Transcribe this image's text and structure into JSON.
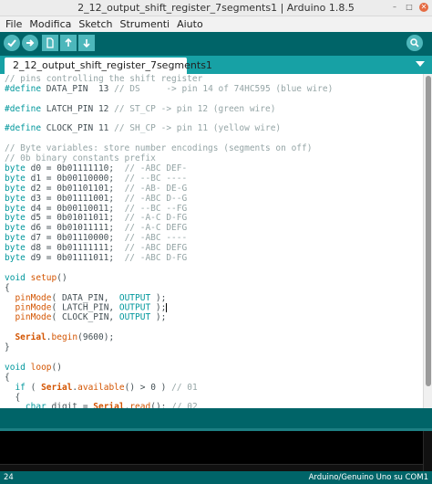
{
  "window": {
    "title": "2_12_output_shift_register_7segments1 | Arduino 1.8.5"
  },
  "menu": [
    "File",
    "Modifica",
    "Sketch",
    "Strumenti",
    "Aiuto"
  ],
  "toolbar": {
    "buttons": [
      "verify-icon",
      "upload-icon",
      "new-icon",
      "open-icon",
      "save-icon",
      "serial-monitor-icon"
    ]
  },
  "tabs": [
    {
      "label": "2_12_output_shift_register_7segments1"
    }
  ],
  "editor": {
    "lines": [
      [
        [
          "cm",
          "// pins controlling the shift register"
        ]
      ],
      [
        [
          "kw",
          "#define"
        ],
        [
          "",
          " DATA_PIN  13 "
        ],
        [
          "cm",
          "// DS     -> pin 14 of 74HC595 (blue wire)"
        ]
      ],
      [
        [
          "",
          ""
        ]
      ],
      [
        [
          "kw",
          "#define"
        ],
        [
          "",
          " LATCH_PIN 12 "
        ],
        [
          "cm",
          "// ST_CP -> pin 12 (green wire)"
        ]
      ],
      [
        [
          "",
          ""
        ]
      ],
      [
        [
          "kw",
          "#define"
        ],
        [
          "",
          " CLOCK_PIN 11 "
        ],
        [
          "cm",
          "// SH_CP -> pin 11 (yellow wire)"
        ]
      ],
      [
        [
          "",
          ""
        ]
      ],
      [
        [
          "cm",
          "// Byte variables: store number encodings (segments on off)"
        ]
      ],
      [
        [
          "cm",
          "// 0b binary constants prefix"
        ]
      ],
      [
        [
          "kw",
          "byte"
        ],
        [
          "",
          " d0 = 0b01111110;  "
        ],
        [
          "cm",
          "// -ABC DEF-"
        ]
      ],
      [
        [
          "kw",
          "byte"
        ],
        [
          "",
          " d1 = 0b00110000;  "
        ],
        [
          "cm",
          "// --BC ----"
        ]
      ],
      [
        [
          "kw",
          "byte"
        ],
        [
          "",
          " d2 = 0b01101101;  "
        ],
        [
          "cm",
          "// -AB- DE-G"
        ]
      ],
      [
        [
          "kw",
          "byte"
        ],
        [
          "",
          " d3 = 0b01111001;  "
        ],
        [
          "cm",
          "// -ABC D--G"
        ]
      ],
      [
        [
          "kw",
          "byte"
        ],
        [
          "",
          " d4 = 0b00110011;  "
        ],
        [
          "cm",
          "// --BC --FG"
        ]
      ],
      [
        [
          "kw",
          "byte"
        ],
        [
          "",
          " d5 = 0b01011011;  "
        ],
        [
          "cm",
          "// -A-C D-FG"
        ]
      ],
      [
        [
          "kw",
          "byte"
        ],
        [
          "",
          " d6 = 0b01011111;  "
        ],
        [
          "cm",
          "// -A-C DEFG"
        ]
      ],
      [
        [
          "kw",
          "byte"
        ],
        [
          "",
          " d7 = 0b01110000;  "
        ],
        [
          "cm",
          "// -ABC ----"
        ]
      ],
      [
        [
          "kw",
          "byte"
        ],
        [
          "",
          " d8 = 0b01111111;  "
        ],
        [
          "cm",
          "// -ABC DEFG"
        ]
      ],
      [
        [
          "kw",
          "byte"
        ],
        [
          "",
          " d9 = 0b01111011;  "
        ],
        [
          "cm",
          "// -ABC D-FG"
        ]
      ],
      [
        [
          "",
          ""
        ]
      ],
      [
        [
          "kw",
          "void"
        ],
        [
          "",
          " "
        ],
        [
          "fn",
          "setup"
        ],
        [
          "",
          "()"
        ]
      ],
      [
        [
          "",
          "{"
        ]
      ],
      [
        [
          "",
          "  "
        ],
        [
          "fn",
          "pinMode"
        ],
        [
          "",
          "( DATA_PIN,  "
        ],
        [
          "kw",
          "OUTPUT"
        ],
        [
          "",
          " );"
        ]
      ],
      [
        [
          "",
          "  "
        ],
        [
          "fn",
          "pinMode"
        ],
        [
          "",
          "( LATCH_PIN, "
        ],
        [
          "kw",
          "OUTPUT"
        ],
        [
          "",
          " );"
        ],
        [
          "caret",
          ""
        ]
      ],
      [
        [
          "",
          "  "
        ],
        [
          "fn",
          "pinMode"
        ],
        [
          "",
          "( CLOCK_PIN, "
        ],
        [
          "kw",
          "OUTPUT"
        ],
        [
          "",
          " );"
        ]
      ],
      [
        [
          "",
          ""
        ]
      ],
      [
        [
          "",
          "  "
        ],
        [
          "cls",
          "Serial"
        ],
        [
          "",
          "."
        ],
        [
          "fn",
          "begin"
        ],
        [
          "",
          "(9600);"
        ]
      ],
      [
        [
          "",
          "}"
        ]
      ],
      [
        [
          "",
          ""
        ]
      ],
      [
        [
          "kw",
          "void"
        ],
        [
          "",
          " "
        ],
        [
          "fn",
          "loop"
        ],
        [
          "",
          "()"
        ]
      ],
      [
        [
          "",
          "{"
        ]
      ],
      [
        [
          "",
          "  "
        ],
        [
          "kw",
          "if"
        ],
        [
          "",
          " ( "
        ],
        [
          "cls",
          "Serial"
        ],
        [
          "",
          "."
        ],
        [
          "fn",
          "available"
        ],
        [
          "",
          "() > 0 ) "
        ],
        [
          "cm",
          "// 01"
        ]
      ],
      [
        [
          "",
          "  {"
        ]
      ],
      [
        [
          "",
          "    "
        ],
        [
          "kw",
          "char"
        ],
        [
          "",
          " digit = "
        ],
        [
          "cls",
          "Serial"
        ],
        [
          "",
          "."
        ],
        [
          "fn",
          "read"
        ],
        [
          "",
          "(); "
        ],
        [
          "cm",
          "// 02"
        ]
      ]
    ]
  },
  "status": {
    "line": "24",
    "board": "Arduino/Genuino Uno su COM1"
  },
  "colors": {
    "toolbar": "#006468",
    "tabbar": "#17a1a5",
    "button": "#4db7bb",
    "keyword": "#00979c",
    "function": "#d35400",
    "comment": "#95a5a6"
  }
}
